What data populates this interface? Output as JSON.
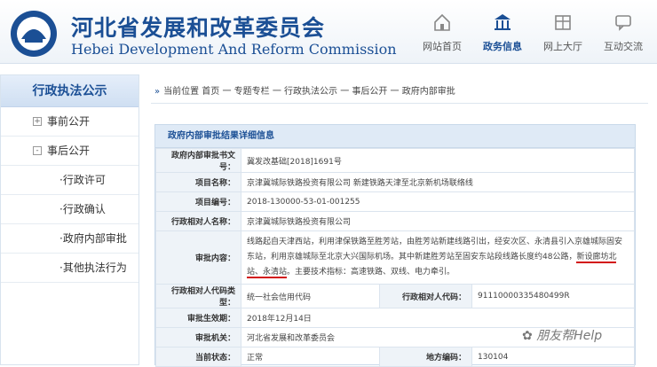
{
  "header": {
    "title_cn": "河北省发展和改革委员会",
    "title_en": "Hebei Development And Reform Commission",
    "nav": [
      {
        "label": "网站首页",
        "icon": "home-icon"
      },
      {
        "label": "政务信息",
        "icon": "building-icon",
        "active": true
      },
      {
        "label": "网上大厅",
        "icon": "hall-icon"
      },
      {
        "label": "互动交流",
        "icon": "chat-icon"
      }
    ]
  },
  "sidebar": {
    "title": "行政执法公示",
    "items": [
      {
        "label": "事前公开"
      },
      {
        "label": "事后公开"
      },
      {
        "label": "·行政许可"
      },
      {
        "label": "·行政确认"
      },
      {
        "label": "·政府内部审批"
      },
      {
        "label": "·其他执法行为"
      }
    ]
  },
  "breadcrumb": {
    "text": "当前位置 首页 一 专题专栏 一 行政执法公示 一 事后公开 一 政府内部审批"
  },
  "panel": {
    "title": "政府内部审批结果详细信息",
    "rows": [
      {
        "key": "政府内部审批书文号：",
        "value": "冀发改基础[2018]1691号"
      },
      {
        "key": "项目名称：",
        "value": "京津冀城际铁路投资有限公司 新建铁路天津至北京新机场联络线"
      },
      {
        "key": "项目编号：",
        "value": "2018-130000-53-01-001255"
      },
      {
        "key": "行政相对人名称：",
        "value": "京津冀城际铁路投资有限公司"
      },
      {
        "key": "审批内容：",
        "value_a": "线路起自天津西站，利用津保铁路至胜芳站，由胜芳站新建线路引出，经安次区、永清县引入京雄城际固安东站，利用京雄城际至北京大兴国际机场。其中新建胜芳站至固安东站段线路长度约48公路，",
        "value_b": "新设廊坊北站、永清站",
        "value_c": "。主要技术指标：高速铁路、双线、电力牵引。"
      },
      {
        "key": "行政相对人代码类型：",
        "value": "统一社会信用代码",
        "key2": "行政相对人代码：",
        "value2": "91110000335480499R"
      },
      {
        "key": "审批生效期：",
        "value": "2018年12月14日"
      },
      {
        "key": "审批机关：",
        "value": "河北省发展和改革委员会"
      },
      {
        "key": "当前状态：",
        "value": "正常",
        "key2": "地方编码：",
        "value2": "130104"
      }
    ]
  },
  "watermark": "朋友帮Help"
}
